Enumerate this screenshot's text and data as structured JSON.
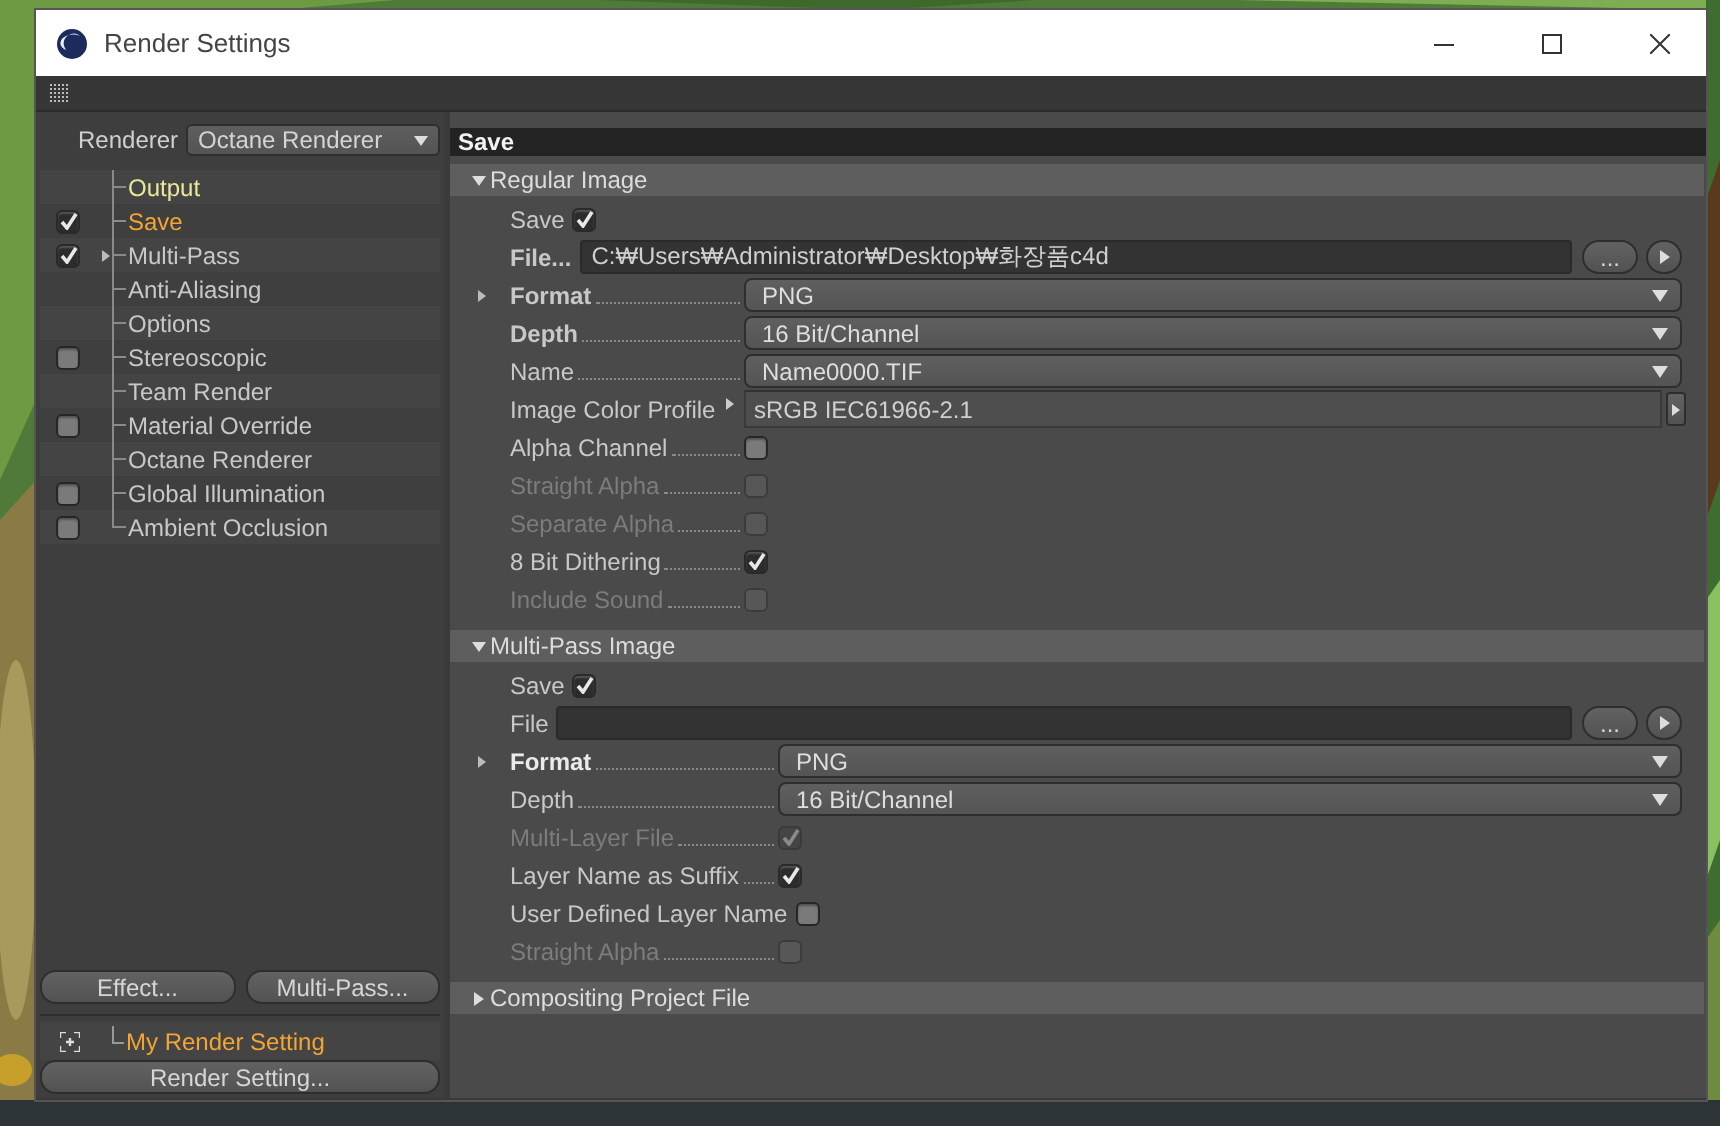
{
  "window": {
    "title": "Render Settings"
  },
  "renderer": {
    "label": "Renderer",
    "value": "Octane Renderer"
  },
  "tree": [
    {
      "label": "Output",
      "has_checkbox": false,
      "selected": false,
      "highlighted": true,
      "expandable": false
    },
    {
      "label": "Save",
      "has_checkbox": true,
      "checked": true,
      "selected": true,
      "highlighted": false,
      "expandable": false
    },
    {
      "label": "Multi-Pass",
      "has_checkbox": true,
      "checked": true,
      "selected": false,
      "highlighted": false,
      "expandable": true
    },
    {
      "label": "Anti-Aliasing",
      "has_checkbox": false,
      "selected": false,
      "highlighted": false,
      "expandable": false
    },
    {
      "label": "Options",
      "has_checkbox": false,
      "selected": false,
      "highlighted": false,
      "expandable": false
    },
    {
      "label": "Stereoscopic",
      "has_checkbox": true,
      "checked": false,
      "selected": false,
      "highlighted": false,
      "expandable": false
    },
    {
      "label": "Team Render",
      "has_checkbox": false,
      "selected": false,
      "highlighted": false,
      "expandable": false
    },
    {
      "label": "Material Override",
      "has_checkbox": true,
      "checked": false,
      "selected": false,
      "highlighted": false,
      "expandable": false
    },
    {
      "label": "Octane Renderer",
      "has_checkbox": false,
      "selected": false,
      "highlighted": false,
      "expandable": false
    },
    {
      "label": "Global Illumination",
      "has_checkbox": true,
      "checked": false,
      "selected": false,
      "highlighted": false,
      "expandable": false
    },
    {
      "label": "Ambient Occlusion",
      "has_checkbox": true,
      "checked": false,
      "selected": false,
      "highlighted": false,
      "expandable": false
    }
  ],
  "effect_buttons": [
    "Effect...",
    "Multi-Pass..."
  ],
  "presets": [
    {
      "label": "My Render Setting",
      "selected": true
    }
  ],
  "render_setting_button": "Render Setting...",
  "page_title": "Save",
  "sections": [
    {
      "title": "Regular Image",
      "expanded": true,
      "rows": [
        {
          "kind": "check",
          "label": "Save",
          "checked": true,
          "disabled": false,
          "leader": false
        },
        {
          "kind": "file",
          "label": "File...",
          "value": "C:₩Users₩Administrator₩Desktop₩화장품c4d",
          "bold": true,
          "button": "..."
        },
        {
          "kind": "dropdown",
          "label": "Format",
          "value": "PNG",
          "bold": true,
          "expandable": true
        },
        {
          "kind": "dropdown",
          "label": "Depth",
          "value": "16 Bit/Channel",
          "bold": true,
          "expandable": false
        },
        {
          "kind": "dropdown",
          "label": "Name",
          "value": "Name0000.TIF",
          "bold": false,
          "expandable": false
        },
        {
          "kind": "profile",
          "label": "Image Color Profile",
          "value": "sRGB IEC61966-2.1"
        },
        {
          "kind": "check",
          "label": "Alpha Channel",
          "checked": false,
          "disabled": false,
          "leader": true
        },
        {
          "kind": "check",
          "label": "Straight Alpha",
          "checked": false,
          "disabled": true,
          "leader": true
        },
        {
          "kind": "check",
          "label": "Separate Alpha",
          "checked": false,
          "disabled": true,
          "leader": true
        },
        {
          "kind": "check",
          "label": "8 Bit Dithering",
          "checked": true,
          "disabled": false,
          "leader": true
        },
        {
          "kind": "check",
          "label": "Include Sound",
          "checked": false,
          "disabled": true,
          "leader": true
        }
      ]
    },
    {
      "title": "Multi-Pass Image",
      "expanded": true,
      "rows": [
        {
          "kind": "check",
          "label": "Save",
          "checked": true,
          "disabled": false,
          "leader": false
        },
        {
          "kind": "file",
          "label": "File",
          "bold": false,
          "button": "..."
        },
        {
          "kind": "dropdown",
          "label": "Format",
          "value": "PNG",
          "bold": true,
          "expandable": true
        },
        {
          "kind": "dropdown",
          "label": "Depth",
          "value": "16 Bit/Channel",
          "bold": false,
          "expandable": false
        },
        {
          "kind": "check",
          "label": "Multi-Layer File",
          "checked": true,
          "disabled": true,
          "leader": true
        },
        {
          "kind": "check",
          "label": "Layer Name as Suffix",
          "checked": true,
          "disabled": false,
          "leader": true
        },
        {
          "kind": "check",
          "label": "User Defined Layer Name",
          "checked": false,
          "disabled": false,
          "leader": false
        },
        {
          "kind": "check",
          "label": "Straight Alpha",
          "checked": false,
          "disabled": true,
          "leader": true
        }
      ]
    },
    {
      "title": "Compositing Project File",
      "expanded": false
    }
  ]
}
